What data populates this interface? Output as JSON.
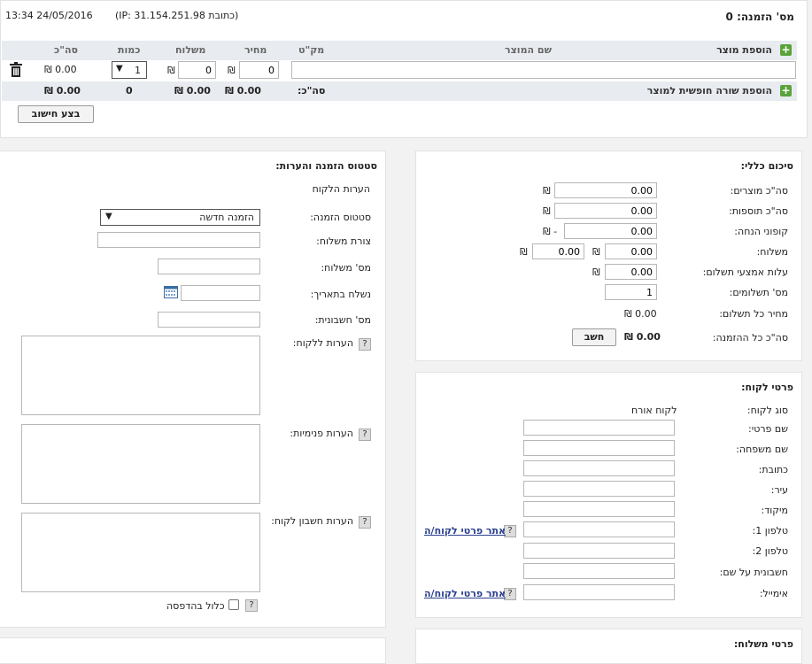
{
  "header": {
    "order_no_label": "מס' הזמנה: 0",
    "ip_label": "(כתובת IP: 31.154.251.98)",
    "datetime": "13:34 24/05/2016"
  },
  "products": {
    "add_product": "הוספת מוצר",
    "columns": {
      "name": "שם המוצר",
      "sku": "מק\"ט",
      "price": "מחיר",
      "shipping": "משלוח",
      "qty": "כמות",
      "total": "סה\"כ"
    },
    "row": {
      "price": "0",
      "shipping": "0",
      "qty": "1",
      "total": "0.00 ₪"
    },
    "add_free_row": "הוספת שורה חופשית למוצר",
    "summary": {
      "label": "סה\"כ:",
      "price": "0.00 ₪",
      "shipping": "0.00 ₪",
      "qty": "0",
      "total": "0.00 ₪"
    },
    "calc_button": "בצע חישוב"
  },
  "currency": "₪",
  "summary": {
    "title": "סיכום כללי:",
    "products_total_label": "סה\"כ מוצרים:",
    "products_total": "0.00",
    "addons_total_label": "סה\"כ תוספות:",
    "addons_total": "0.00",
    "coupons_label": "קופוני הנחה:",
    "coupons": "0.00",
    "coupons_suffix": "- ₪",
    "shipping_label": "משלוח:",
    "shipping_a": "0.00",
    "shipping_b": "0.00",
    "payment_cost_label": "עלות אמצעי תשלום:",
    "payment_cost": "0.00",
    "installments_label": "מס' תשלומים:",
    "installments": "1",
    "installment_price_label": "מחיר כל תשלום:",
    "installment_price": "0.00 ₪",
    "order_total_label": "סה\"כ כל ההזמנה:",
    "order_total": "0.00 ₪",
    "calc_button": "חשב"
  },
  "status": {
    "title": "סטטוס הזמנה והערות:",
    "customer_notes": "הערות הלקוח",
    "order_status_label": "סטטוס הזמנה:",
    "order_status": "הזמנה חדשה",
    "shipping_method_label": "צורת משלוח:",
    "shipping_no_label": "מס' משלוח:",
    "shipped_on_label": "נשלח בתאריך:",
    "invoice_no_label": "מס' חשבונית:",
    "notes_to_customer_label": "הערות ללקוח:",
    "internal_notes_label": "הערות פנימיות:",
    "invoice_notes_label": "הערות חשבון לקוח:",
    "include_print_label": "כלול בהדפסה"
  },
  "customer": {
    "title": "פרטי לקוח:",
    "type_label": "סוג לקוח:",
    "type_value": "לקוח אורח",
    "first_name_label": "שם פרטי:",
    "last_name_label": "שם משפחה:",
    "address_label": "כתובת:",
    "city_label": "עיר:",
    "zip_label": "מיקוד:",
    "phone1_label": "טלפון 1:",
    "phone2_label": "טלפון 2:",
    "invoice_name_label": "חשבונית על שם:",
    "email_label": "אימייל:",
    "find_customer": "אתר פרטי לקוח/ה"
  },
  "shipping_panel": {
    "title": "פרטי משלוח:"
  }
}
